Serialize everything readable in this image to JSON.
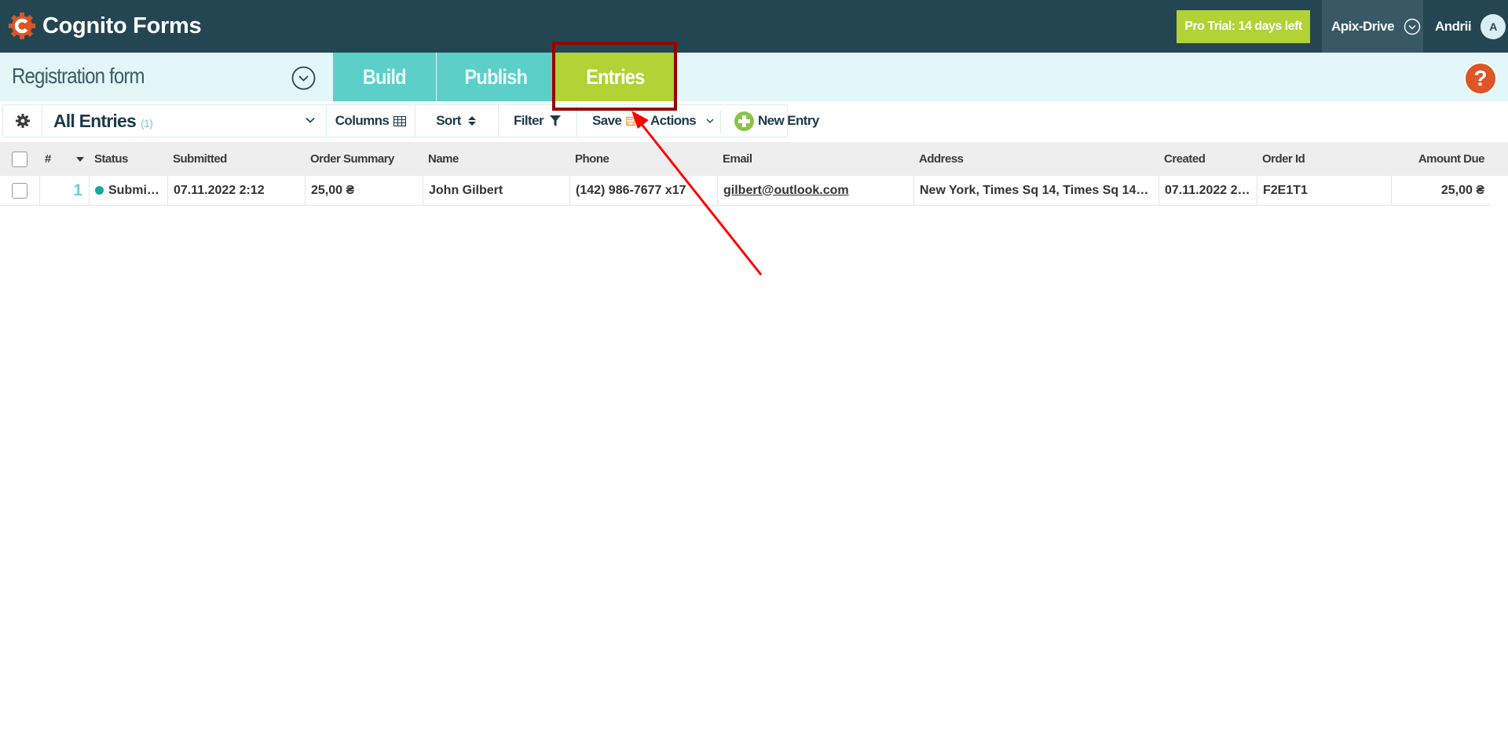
{
  "header": {
    "brand": "Cognito Forms",
    "trial_label": "Pro Trial: 14 days left",
    "organization": "Apix-Drive",
    "user_name": "Andrii",
    "user_initial": "A"
  },
  "subheader": {
    "form_title": "Registration form",
    "tabs": [
      {
        "label": "Build",
        "active": false
      },
      {
        "label": "Publish",
        "active": false
      },
      {
        "label": "Entries",
        "active": true
      }
    ],
    "help_label": "?"
  },
  "toolbar": {
    "view_label": "All Entries",
    "view_count": "(1)",
    "columns_label": "Columns",
    "sort_label": "Sort",
    "filter_label": "Filter",
    "save_label": "Save",
    "actions_label": "Actions",
    "new_entry_label": "New Entry"
  },
  "table": {
    "columns": [
      "#",
      "Status",
      "Submitted",
      "Order Summary",
      "Name",
      "Phone",
      "Email",
      "Address",
      "Created",
      "Order Id",
      "Amount Due"
    ],
    "rows": [
      {
        "number": "1",
        "status": "Submi…",
        "submitted": "07.11.2022 2:12",
        "order_summary": "25,00 ₴",
        "name": "John Gilbert",
        "phone": "(142) 986-7677 x17",
        "email": "gilbert@outlook.com",
        "address": "New York, Times Sq 14, Times Sq 14…",
        "created": "07.11.2022 2…",
        "order_id": "F2E1T1",
        "amount_due": "25,00 ₴"
      }
    ]
  },
  "colors": {
    "header_bg": "#244653",
    "accent_green": "#b2d235",
    "tab_teal": "#5ccfc9",
    "subheader_bg": "#e3f6f8",
    "brand_orange": "#de5526",
    "status_submitted": "#15a999",
    "annotation_red": "#ff0000",
    "annotation_box": "#9b0000"
  }
}
